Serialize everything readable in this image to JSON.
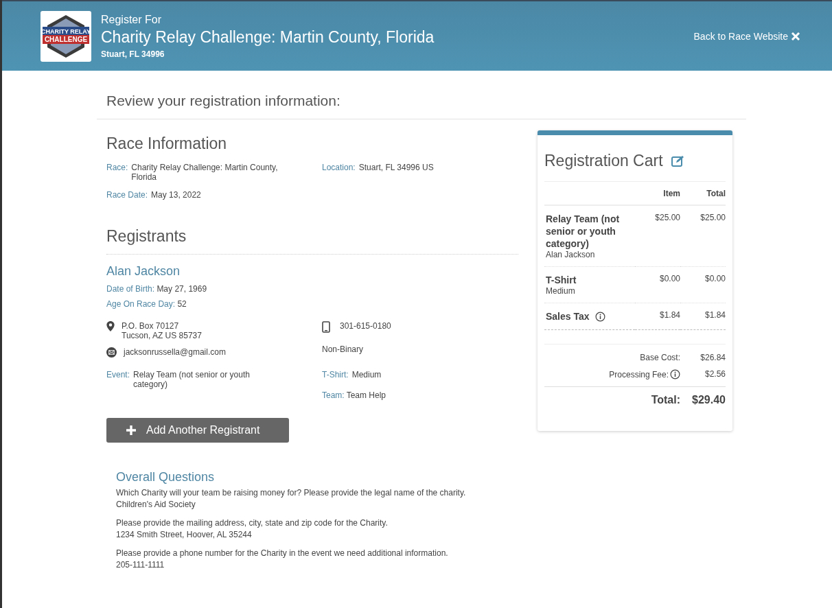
{
  "header": {
    "logo_lines": [
      "CHARITY RELAY",
      "CHALLENGE"
    ],
    "kicker": "Register For",
    "title": "Charity Relay Challenge: Martin County, Florida",
    "location": "Stuart, FL 34996",
    "back_link": "Back to Race Website"
  },
  "page_title": "Review your registration information:",
  "race_info": {
    "heading": "Race Information",
    "fields": [
      {
        "label": "Race:",
        "value": "Charity Relay Challenge: Martin County, Florida"
      },
      {
        "label": "Location:",
        "value": "Stuart, FL 34996 US"
      },
      {
        "label": "Race Date:",
        "value": "May 13, 2022"
      }
    ]
  },
  "registrants": {
    "heading": "Registrants",
    "people": [
      {
        "name": "Alan Jackson",
        "dob_label": "Date of Birth:",
        "dob": "May 27, 1969",
        "age_label": "Age On Race Day:",
        "age": "52",
        "address": [
          "P.O. Box 70127",
          "Tucson, AZ US 85737"
        ],
        "email": "jacksonrussella@gmail.com",
        "phone": "301-615-0180",
        "gender": "Non-Binary",
        "event_label": "Event:",
        "event": "Relay Team (not senior or youth category)",
        "tshirt_label": "T-Shirt:",
        "tshirt": "Medium",
        "team_label": "Team:",
        "team": "Team Help"
      }
    ]
  },
  "add_button": "Add Another Registrant",
  "questions": {
    "heading": "Overall Questions",
    "items": [
      {
        "question": "Which Charity will your team be raising money for? Please provide the legal name of the charity.",
        "answer": "Children's Aid Society"
      },
      {
        "question": "Please provide the mailing address, city, state and zip code for the Charity.",
        "answer": "1234 Smith Street, Hoover, AL 35244"
      },
      {
        "question": "Please provide a phone number for the Charity in the event we need additional information.",
        "answer": "205-111-1111"
      }
    ]
  },
  "cart": {
    "title": "Registration Cart",
    "columns": [
      "Item",
      "Total"
    ],
    "lines": [
      {
        "name": "Relay Team (not senior or youth category)",
        "detail": "Alan Jackson",
        "info": false,
        "item": "$25.00",
        "total": "$25.00"
      },
      {
        "name": "T-Shirt",
        "detail": "Medium",
        "info": false,
        "item": "$0.00",
        "total": "$0.00"
      },
      {
        "name": "Sales Tax",
        "info": true,
        "item": "$1.84",
        "total": "$1.84"
      }
    ],
    "summary": [
      {
        "label": "Base Cost:",
        "info": false,
        "value": "$26.84"
      },
      {
        "label": "Processing Fee:",
        "info": true,
        "value": "$2.56"
      }
    ],
    "total_label": "Total:",
    "total": "$29.40"
  }
}
